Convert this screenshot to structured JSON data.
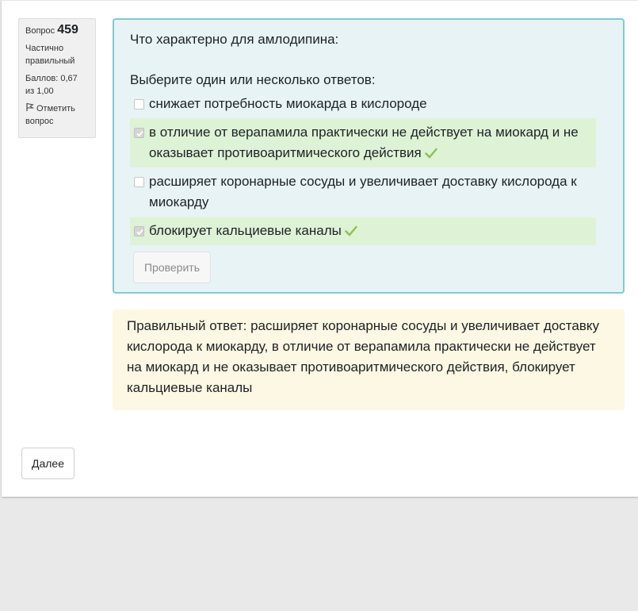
{
  "info": {
    "question_label": "Вопрос",
    "question_number": "459",
    "state": "Частично правильный",
    "grade": "Баллов: 0,67 из 1,00",
    "flag_label": "Отметить вопрос"
  },
  "question": {
    "text": "Что характерно для амлодипина:",
    "prompt": "Выберите один или несколько ответов:",
    "answers": [
      {
        "label": "снижает потребность миокарда в кислороде",
        "checked": false,
        "correct": false
      },
      {
        "label": "в отличие от верапамила практически не действует на миокард и не оказывает противоаритмического действия",
        "checked": true,
        "correct": true
      },
      {
        "label": "расширяет коронарные сосуды и увеличивает доставку кислорода к миокарду",
        "checked": false,
        "correct": false
      },
      {
        "label": "блокирует кальциевые каналы",
        "checked": true,
        "correct": true
      }
    ],
    "check_button": "Проверить"
  },
  "feedback": {
    "text": "Правильный ответ: расширяет коронарные сосуды и увеличивает доставку кислорода к миокарду, в отличие от верапамила практически не действует на миокард и не оказывает противоаритмического действия, блокирует кальциевые каналы"
  },
  "navigation": {
    "next_button": "Далее"
  },
  "colors": {
    "question_bg": "#e7f3f5",
    "question_border": "#7fcad4",
    "correct_bg": "#def2d6",
    "feedback_bg": "#fcf8e3",
    "check_mark": "#8bc34a"
  },
  "icons": {
    "flag": "flag-icon",
    "correct": "check-icon"
  }
}
